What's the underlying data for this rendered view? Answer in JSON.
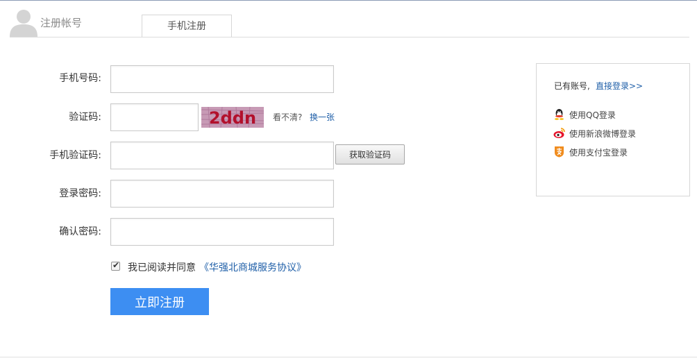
{
  "header": {
    "title": "注册帐号",
    "tab_label": "手机注册"
  },
  "form": {
    "phone_label": "手机号码:",
    "phone_value": "",
    "captcha_label": "验证码:",
    "captcha_value": "",
    "captcha_image_text": "2ddn",
    "captcha_hint": "看不清?",
    "captcha_refresh": "换一张",
    "sms_label": "手机验证码:",
    "sms_value": "",
    "sms_button": "获取验证码",
    "password_label": "登录密码:",
    "password_value": "",
    "confirm_label": "确认密码:",
    "confirm_value": "",
    "agree_checked": true,
    "agree_text": "我已阅读并同意",
    "agree_link": "《华强北商城服务协议》",
    "submit_label": "立即注册"
  },
  "side": {
    "have_account": "已有账号,",
    "login_link": "直接登录>>",
    "items": [
      {
        "icon": "qq-icon",
        "label": "使用QQ登录"
      },
      {
        "icon": "weibo-icon",
        "label": "使用新浪微博登录"
      },
      {
        "icon": "alipay-icon",
        "label": "使用支付宝登录"
      }
    ]
  },
  "colors": {
    "accent": "#3d8ef2",
    "link": "#1f5fa8",
    "captcha_bg": "#c79ab5",
    "captcha_text": "#b2102c"
  }
}
